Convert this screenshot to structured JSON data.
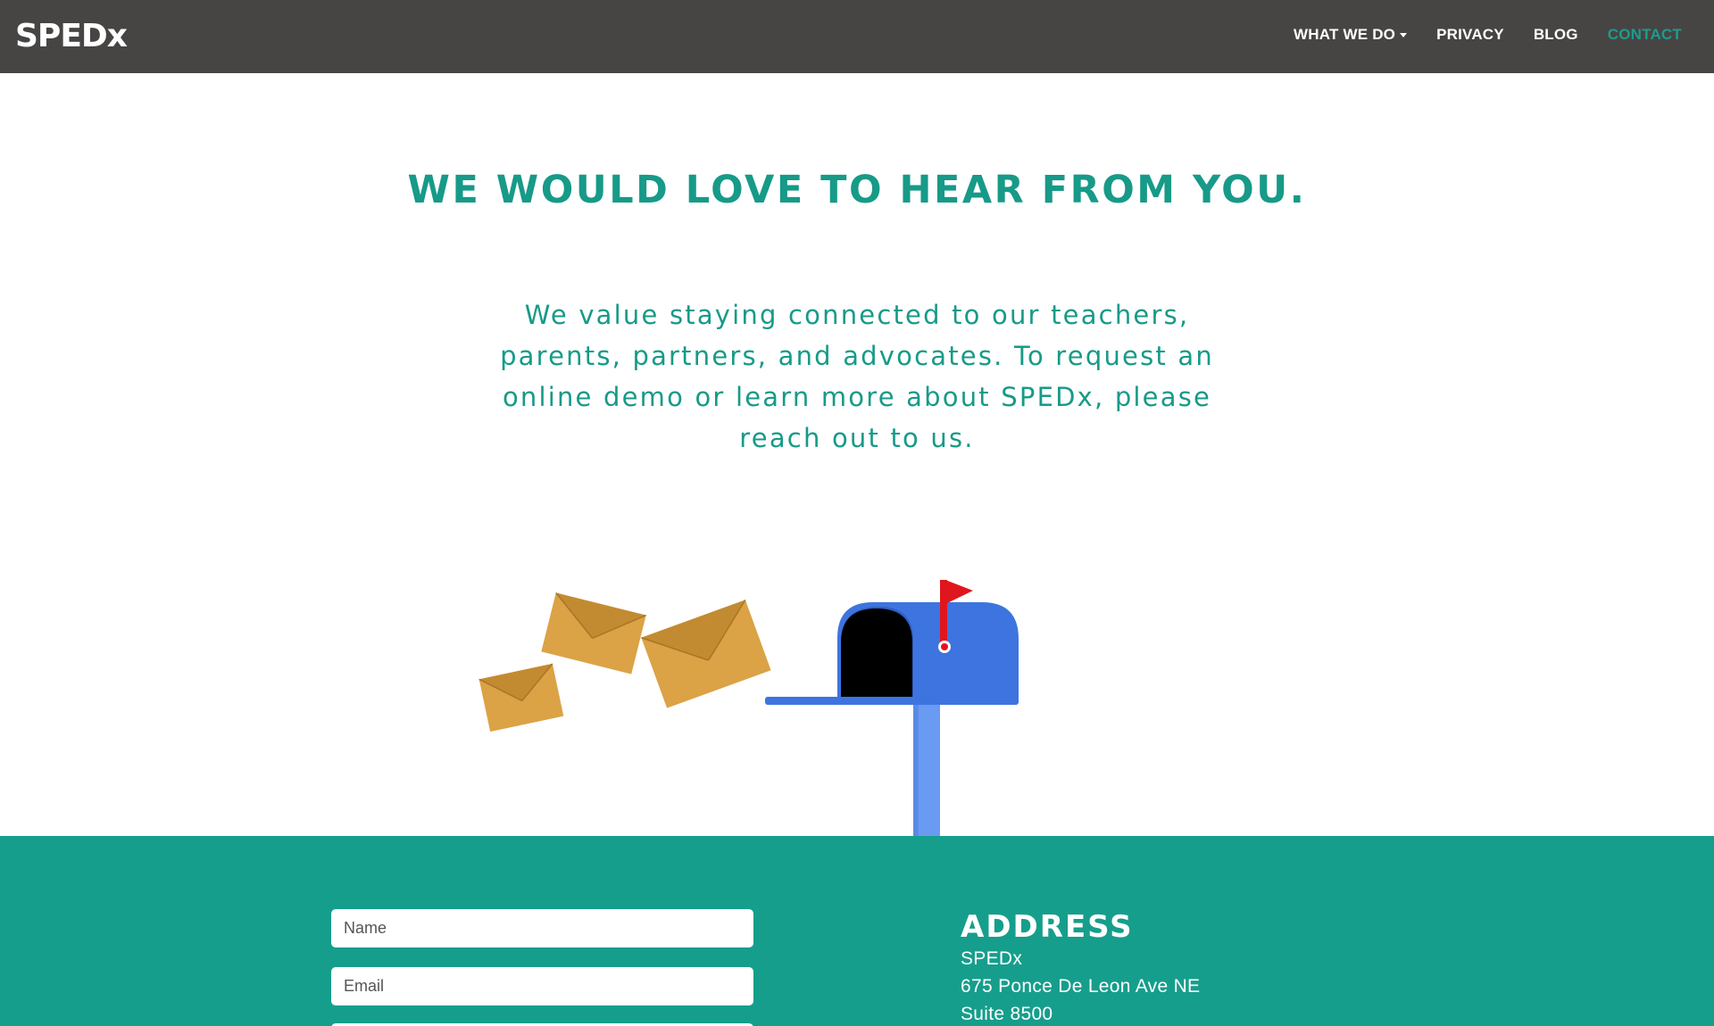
{
  "nav": {
    "logo": "SPEDx",
    "items": [
      {
        "label": "WHAT WE DO",
        "has_dropdown": true
      },
      {
        "label": "PRIVACY"
      },
      {
        "label": "BLOG"
      },
      {
        "label": "CONTACT",
        "active": true
      }
    ]
  },
  "hero": {
    "title": "WE WOULD LOVE TO HEAR FROM YOU.",
    "text": "We value staying connected to our teachers, parents, partners, and advocates. To request an online demo or learn more about SPEDx, please reach out to us."
  },
  "illustration": {
    "icons": [
      "envelope-icon",
      "envelope-icon",
      "envelope-icon",
      "mailbox-icon",
      "flag-icon"
    ]
  },
  "form": {
    "name_placeholder": "Name",
    "email_placeholder": "Email"
  },
  "address": {
    "heading": "ADDRESS",
    "lines": [
      "SPEDx",
      "675 Ponce De Leon Ave NE",
      "Suite 8500"
    ]
  },
  "colors": {
    "navbar": "#474444",
    "accent": "#179a88",
    "footer": "#169e8c",
    "mailbox": "#3d74e0",
    "flag": "#e0161e",
    "envelope": "#dba246"
  }
}
